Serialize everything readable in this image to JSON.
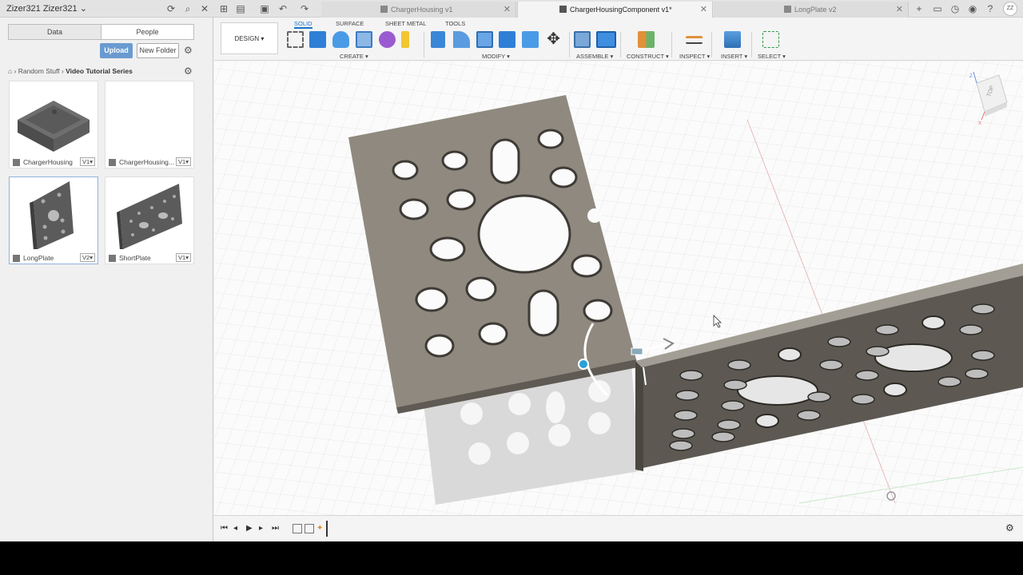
{
  "user": {
    "name": "Zizer321 Zizer321"
  },
  "tabs": [
    {
      "label": "ChargerHousing v1",
      "active": false
    },
    {
      "label": "ChargerHousingComponent v1*",
      "active": true
    },
    {
      "label": "LongPlate v2",
      "active": false
    }
  ],
  "avatar": {
    "initials": "ZZ"
  },
  "panel": {
    "data_tab": "Data",
    "people_tab": "People",
    "upload_label": "Upload",
    "new_folder_label": "New Folder",
    "breadcrumb": {
      "item1": "Random Stuff",
      "item2": "Video Tutorial Series"
    },
    "files": [
      {
        "name": "ChargerHousing",
        "version": "V1"
      },
      {
        "name": "ChargerHousing...",
        "version": "V1"
      },
      {
        "name": "LongPlate",
        "version": "V2"
      },
      {
        "name": "ShortPlate",
        "version": "V1"
      }
    ]
  },
  "toolbar": {
    "workspace": "DESIGN",
    "tabs": [
      "SOLID",
      "SURFACE",
      "SHEET METAL",
      "TOOLS"
    ],
    "groups": [
      "CREATE",
      "MODIFY",
      "ASSEMBLE",
      "CONSTRUCT",
      "INSPECT",
      "INSERT",
      "SELECT"
    ]
  },
  "viewcube": {
    "face": "TOP"
  },
  "colors": {
    "accent": "#1a73c9",
    "model": "#8f897f",
    "upload": "#6a9bd0"
  }
}
